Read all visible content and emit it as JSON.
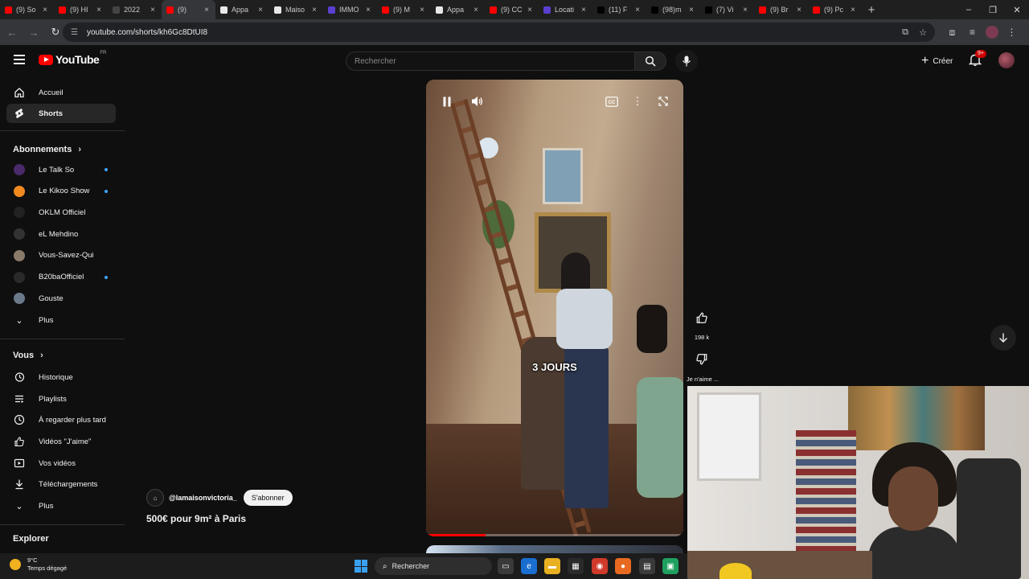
{
  "browser": {
    "tabs": [
      {
        "label": "(9) So",
        "color": "#ff0000"
      },
      {
        "label": "(9) HI",
        "color": "#ff0000"
      },
      {
        "label": "2022",
        "color": "#444444"
      },
      {
        "label": "(9)",
        "color": "#ff0000"
      },
      {
        "label": "Appa",
        "color": "#e8e8e8"
      },
      {
        "label": "Maiso",
        "color": "#e8e8e8"
      },
      {
        "label": "IMMO",
        "color": "#5b3fd0"
      },
      {
        "label": "(9) M",
        "color": "#ff0000"
      },
      {
        "label": "Appa",
        "color": "#e8e8e8"
      },
      {
        "label": "(9) CC",
        "color": "#ff0000"
      },
      {
        "label": "Locati",
        "color": "#5b3fd0"
      },
      {
        "label": "(11) F",
        "color": "#000000"
      },
      {
        "label": "(98)m",
        "color": "#000000"
      },
      {
        "label": "(7) Vi",
        "color": "#000000"
      },
      {
        "label": "(9) Br",
        "color": "#ff0000"
      },
      {
        "label": "(9) Pc",
        "color": "#ff0000"
      }
    ],
    "url": "youtube.com/shorts/kh6Gc8DtUI8"
  },
  "youtube": {
    "logo_text": "YouTube",
    "country": "FR",
    "search_placeholder": "Rechercher",
    "create_label": "Créer",
    "notification_count": "9+"
  },
  "sidebar": {
    "main": [
      {
        "label": "Accueil",
        "icon": "home-icon"
      },
      {
        "label": "Shorts",
        "icon": "shorts-icon",
        "active": true
      }
    ],
    "subscriptions_title": "Abonnements",
    "subscriptions": [
      {
        "label": "Le Talk So",
        "color": "#4a2a6a",
        "new": true
      },
      {
        "label": "Le Kikoo Show",
        "color": "#f08a20",
        "new": true
      },
      {
        "label": "OKLM Officiel",
        "color": "#222222",
        "new": false
      },
      {
        "label": "eL Mehdino",
        "color": "#333333",
        "new": false
      },
      {
        "label": "Vous-Savez-Qui",
        "color": "#8a7a6a",
        "new": false
      },
      {
        "label": "B20baOfficiel",
        "color": "#2a2a2a",
        "new": true
      },
      {
        "label": "Gouste",
        "color": "#6a7a8a",
        "new": false
      }
    ],
    "more_label": "Plus",
    "you_title": "Vous",
    "you_items": [
      {
        "label": "Historique",
        "icon": "history-icon"
      },
      {
        "label": "Playlists",
        "icon": "playlist-icon"
      },
      {
        "label": "À regarder plus tard",
        "icon": "watch-later-icon"
      },
      {
        "label": "Vidéos \"J'aime\"",
        "icon": "thumbs-up-icon"
      },
      {
        "label": "Vos vidéos",
        "icon": "your-videos-icon"
      },
      {
        "label": "Téléchargements",
        "icon": "download-icon"
      }
    ],
    "more_label_2": "Plus",
    "explore_title": "Explorer"
  },
  "short": {
    "caption": "3 JOURS",
    "channel": "@lamaisonvictoria_",
    "subscribe_label": "S'abonner",
    "title": "500€ pour 9m² à Paris",
    "likes": "198 k",
    "dislike_label": "Je n'aime ...",
    "progress": 0.23
  },
  "taskbar": {
    "temperature": "9°C",
    "weather": "Temps dégagé",
    "search_label": "Rechercher"
  }
}
